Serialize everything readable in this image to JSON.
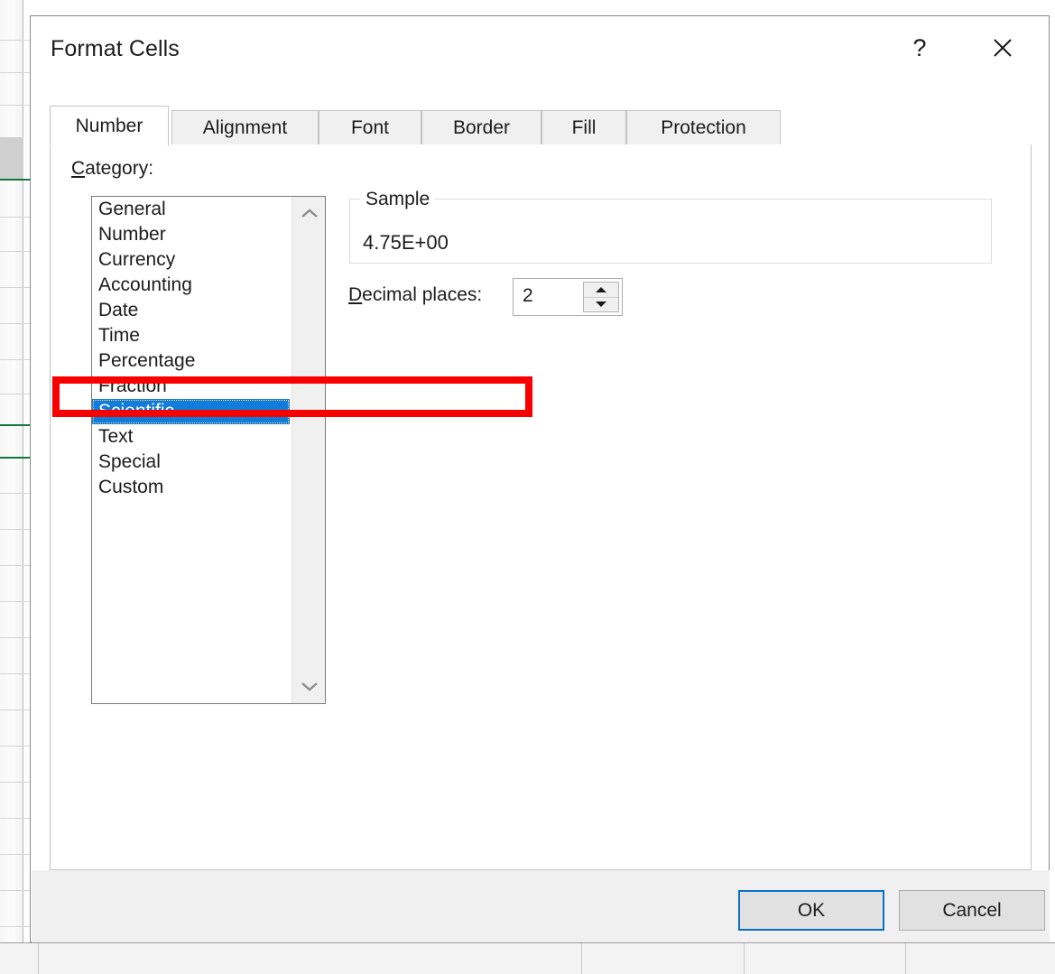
{
  "dialog": {
    "title": "Format Cells",
    "help_button": "?",
    "close_button": "✕",
    "tabs": [
      {
        "label": "Number",
        "active": true
      },
      {
        "label": "Alignment",
        "active": false
      },
      {
        "label": "Font",
        "active": false
      },
      {
        "label": "Border",
        "active": false
      },
      {
        "label": "Fill",
        "active": false
      },
      {
        "label": "Protection",
        "active": false
      }
    ]
  },
  "number_tab": {
    "category_label": "Category:",
    "category_accel": "C",
    "categories": [
      {
        "label": "General",
        "selected": false
      },
      {
        "label": "Number",
        "selected": false
      },
      {
        "label": "Currency",
        "selected": false
      },
      {
        "label": "Accounting",
        "selected": false
      },
      {
        "label": "Date",
        "selected": false
      },
      {
        "label": "Time",
        "selected": false
      },
      {
        "label": "Percentage",
        "selected": false
      },
      {
        "label": "Fraction",
        "selected": false
      },
      {
        "label": "Scientific",
        "selected": true
      },
      {
        "label": "Text",
        "selected": false
      },
      {
        "label": "Special",
        "selected": false
      },
      {
        "label": "Custom",
        "selected": false
      }
    ],
    "selected_category": "Scientific",
    "scroll_up_icon": "chevron-up",
    "scroll_down_icon": "chevron-down",
    "sample": {
      "group_title": "Sample",
      "value": "4.75E+00"
    },
    "decimal_places": {
      "label_accel": "D",
      "label_rest": "ecimal places:",
      "value": "2"
    }
  },
  "footer": {
    "ok_label": "OK",
    "cancel_label": "Cancel"
  },
  "annotation": {
    "color": "#f80000",
    "target": "Scientific"
  },
  "background": {
    "app": "spreadsheet-grid",
    "selection_color": "#13763c"
  }
}
